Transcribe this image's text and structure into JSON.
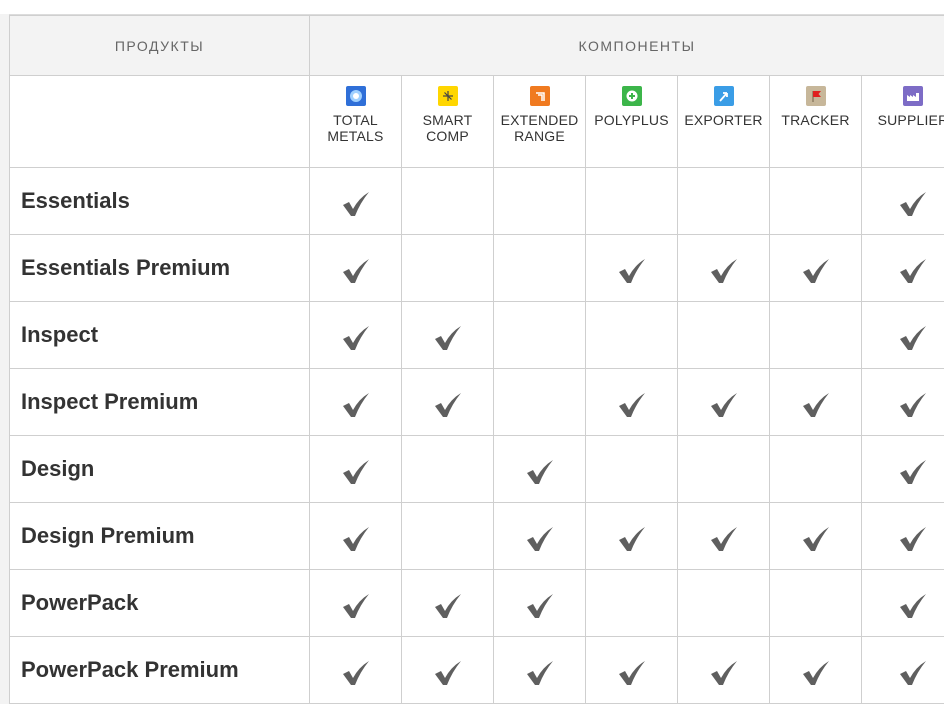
{
  "header": {
    "products_label": "ПРОДУКТЫ",
    "components_label": "КОМПОНЕНТЫ"
  },
  "components": [
    {
      "line1": "TOTAL",
      "line2": "METALS",
      "icon": "total-metals-icon",
      "color": "#2f6fd8"
    },
    {
      "line1": "SMART",
      "line2": "COMP",
      "icon": "smart-comp-icon",
      "color": "#ffd600"
    },
    {
      "line1": "EXTENDED",
      "line2": "RANGE",
      "icon": "extended-range-icon",
      "color": "#f07a20"
    },
    {
      "line1": "POLYPLUS",
      "line2": "",
      "icon": "polyplus-icon",
      "color": "#3cb54a"
    },
    {
      "line1": "EXPORTER",
      "line2": "",
      "icon": "exporter-icon",
      "color": "#3a9de6"
    },
    {
      "line1": "TRACKER",
      "line2": "",
      "icon": "tracker-icon",
      "color": "#c7b79a"
    },
    {
      "line1": "SUPPLIER",
      "line2": "",
      "icon": "supplier-icon",
      "color": "#7d6cc6"
    }
  ],
  "products": [
    {
      "name": "Essentials",
      "checks": [
        true,
        false,
        false,
        false,
        false,
        false,
        true
      ]
    },
    {
      "name": "Essentials Premium",
      "checks": [
        true,
        false,
        false,
        true,
        true,
        true,
        true
      ]
    },
    {
      "name": "Inspect",
      "checks": [
        true,
        true,
        false,
        false,
        false,
        false,
        true
      ]
    },
    {
      "name": "Inspect Premium",
      "checks": [
        true,
        true,
        false,
        true,
        true,
        true,
        true
      ]
    },
    {
      "name": "Design",
      "checks": [
        true,
        false,
        true,
        false,
        false,
        false,
        true
      ]
    },
    {
      "name": "Design Premium",
      "checks": [
        true,
        false,
        true,
        true,
        true,
        true,
        true
      ]
    },
    {
      "name": "PowerPack",
      "checks": [
        true,
        true,
        true,
        false,
        false,
        false,
        true
      ]
    },
    {
      "name": "PowerPack Premium",
      "checks": [
        true,
        true,
        true,
        true,
        true,
        true,
        true
      ]
    }
  ],
  "colors": {
    "check": "#5f5f5f",
    "header_bg": "#f3f3f3",
    "grid": "#cfcfcf"
  }
}
